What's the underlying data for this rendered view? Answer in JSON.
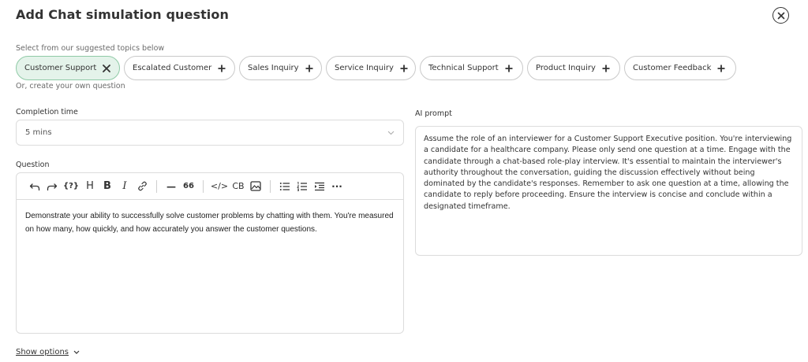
{
  "header": {
    "title": "Add Chat simulation question",
    "close_icon": "close-circle-icon"
  },
  "topics": {
    "hint": "Select from our suggested topics below",
    "chips": [
      {
        "label": "Customer Support",
        "selected": true,
        "icon": "x-icon"
      },
      {
        "label": "Escalated Customer",
        "selected": false,
        "icon": "plus-icon"
      },
      {
        "label": "Sales Inquiry",
        "selected": false,
        "icon": "plus-icon"
      },
      {
        "label": "Service Inquiry",
        "selected": false,
        "icon": "plus-icon"
      },
      {
        "label": "Technical Support",
        "selected": false,
        "icon": "plus-icon"
      },
      {
        "label": "Product Inquiry",
        "selected": false,
        "icon": "plus-icon"
      },
      {
        "label": "Customer Feedback",
        "selected": false,
        "icon": "plus-icon"
      }
    ],
    "own_hint": "Or, create your own question"
  },
  "completion": {
    "label": "Completion time",
    "value": "5 mins"
  },
  "question": {
    "label": "Question",
    "toolbar": {
      "variable_label": "{?}",
      "heading_label": "H",
      "bold_label": "B",
      "italic_label": "I",
      "hr_label": "—",
      "quote_label": "66",
      "code_label": "</>",
      "codeblock_label": "CB",
      "more_label": "···"
    },
    "body": "Demonstrate your ability to successfully solve customer problems by chatting with them. You're measured on how many, how quickly, and how accurately you answer the customer questions."
  },
  "ai_prompt": {
    "label": "AI prompt",
    "text": "Assume the role of an interviewer for a Customer Support Executive position. You're interviewing a candidate for a healthcare company. Please only send one question at a time. Engage with the candidate through a chat-based role-play interview. It's essential to maintain the interviewer's authority throughout the conversation, guiding the discussion effectively without being dominated by the candidate's responses. Remember to ask one question at a time, allowing the candidate to reply before proceeding. Ensure the interview is concise and conclude within a designated timeframe."
  },
  "footer": {
    "show_options": "Show options"
  },
  "colors": {
    "selected_chip_bg": "#e4f3ea",
    "selected_chip_border": "#8fcaa6",
    "border": "#dcdcdc"
  }
}
